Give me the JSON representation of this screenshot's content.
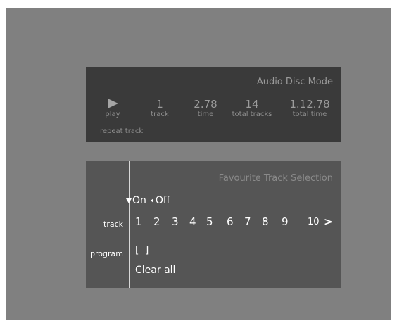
{
  "status": {
    "mode_title": "Audio Disc Mode",
    "play_label": "play",
    "play_icon": "play-icon",
    "track_value": "1",
    "track_label": "track",
    "time_value": "2.78",
    "time_label": "time",
    "total_tracks_value": "14",
    "total_tracks_label": "total tracks",
    "total_time_value": "1.12.78",
    "total_time_label": "total time",
    "repeat_label": "repeat track"
  },
  "favourites": {
    "title": "Favourite Track Selection",
    "on_label": "On",
    "off_label": "Off",
    "track_row_label": "track",
    "program_row_label": "program",
    "track_numbers": [
      "1",
      "2",
      "3",
      "4",
      "5",
      "6",
      "7",
      "8",
      "9",
      "10"
    ],
    "next_label": ">",
    "program_value": "[ ]",
    "clear_all_label": "Clear all"
  },
  "colors": {
    "background": "#808080",
    "status_panel": "#3a3a3a",
    "favourites_panel": "#555555",
    "text_bright": "#ffffff",
    "text_dim": "#9b9b9b"
  }
}
